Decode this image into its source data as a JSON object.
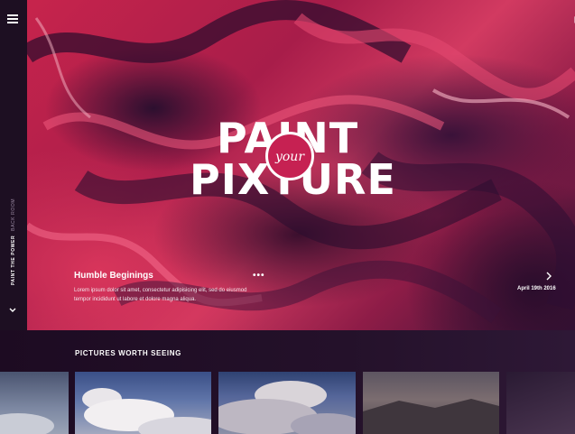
{
  "sidebar": {
    "menu_icon": "hamburger-icon",
    "vertical_main": "PAINT THE POWER",
    "vertical_sub": "BACK ROOM",
    "down_icon": "chevron-down-icon"
  },
  "header": {
    "mail_icon": "mail-icon"
  },
  "hero": {
    "logo_line1": "PAINT",
    "logo_line2": "PIXTURE",
    "logo_badge": "your",
    "title": "Humble Beginings",
    "more": "•••",
    "description": "Lorem ipsum dolor sit amet, consectetur adipisicing elit, sed do eiusmod tempor incididunt ut labore et dolore magna aliqua.",
    "date": "April 19th 2016",
    "next_icon": "chevron-right-icon"
  },
  "gallery": {
    "title": "PICTURES WORTH SEEING"
  },
  "colors": {
    "accent": "#c62152",
    "background": "#1a0c20"
  }
}
